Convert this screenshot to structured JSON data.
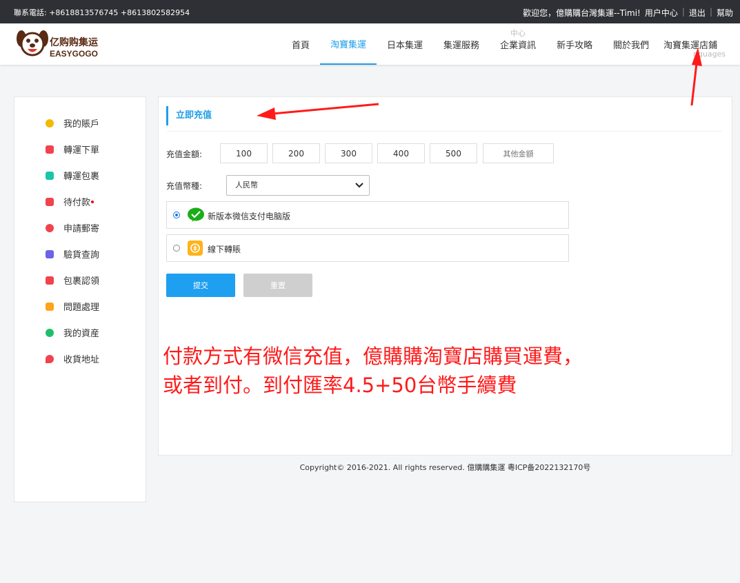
{
  "topbar": {
    "phone": "聯系電話: +8618813576745 +8613802582954",
    "welcome": "歡迎您，億購購台灣集運--Timi!",
    "user_center": "用户中心",
    "logout": "退出",
    "help": "幫助"
  },
  "logo": {
    "cn": "亿购购集运",
    "en": "EASYGOGO"
  },
  "nav": {
    "items": [
      {
        "label": "首頁"
      },
      {
        "label": "淘寶集運"
      },
      {
        "label": "日本集運"
      },
      {
        "label": "集運服務"
      },
      {
        "label": "企業資訊",
        "sub": "中心"
      },
      {
        "label": "新手攻略"
      },
      {
        "label": "關於我們"
      },
      {
        "label": "淘寶集運店鋪",
        "sub": "nguages"
      }
    ]
  },
  "sidebar": {
    "items": [
      {
        "label": "我的賬戶",
        "icon": "user-icon",
        "color": "#f5b800"
      },
      {
        "label": "轉運下單",
        "icon": "order-icon",
        "color": "#f0434d"
      },
      {
        "label": "轉運包裹",
        "icon": "package-icon",
        "color": "#19c6a8"
      },
      {
        "label": "待付款",
        "icon": "wallet-icon",
        "color": "#f0434d"
      },
      {
        "label": "申請郵寄",
        "icon": "mail-icon",
        "color": "#f0434d"
      },
      {
        "label": "驗貨查詢",
        "icon": "inspect-icon",
        "color": "#6b63e8"
      },
      {
        "label": "包裹認領",
        "icon": "claim-icon",
        "color": "#f0434d"
      },
      {
        "label": "問題處理",
        "icon": "problem-icon",
        "color": "#ffa31a"
      },
      {
        "label": "我的資産",
        "icon": "asset-icon",
        "color": "#1fbf6a"
      },
      {
        "label": "收貨地址",
        "icon": "location-icon",
        "color": "#f0434d"
      }
    ]
  },
  "recharge": {
    "title": "立即充值",
    "amount_label": "充值金額:",
    "amounts": [
      "100",
      "200",
      "300",
      "400",
      "500"
    ],
    "other_amount": "其他金額",
    "currency_label": "充值幣種:",
    "currency_value": "人民幣",
    "pay_methods": [
      {
        "label": "新版本微信支付电脑版",
        "selected": true,
        "icon": "wechat-pay-icon"
      },
      {
        "label": "線下轉賬",
        "selected": false,
        "icon": "offline-transfer-icon"
      }
    ],
    "submit": "提交",
    "reset": "重置"
  },
  "annotation": {
    "line1": "付款方式有微信充值，億購購淘寶店購買運費，",
    "line2": "或者到付。到付匯率4.5+50台幣手續費"
  },
  "footer": {
    "copyright": "Copyright© 2016-2021. All rights reserved. 億購購集運 粵ICP备2022132170号"
  },
  "colors": {
    "accent": "#1e9ee8",
    "annotation": "#ff1a1a",
    "topbar": "#2f3035"
  }
}
